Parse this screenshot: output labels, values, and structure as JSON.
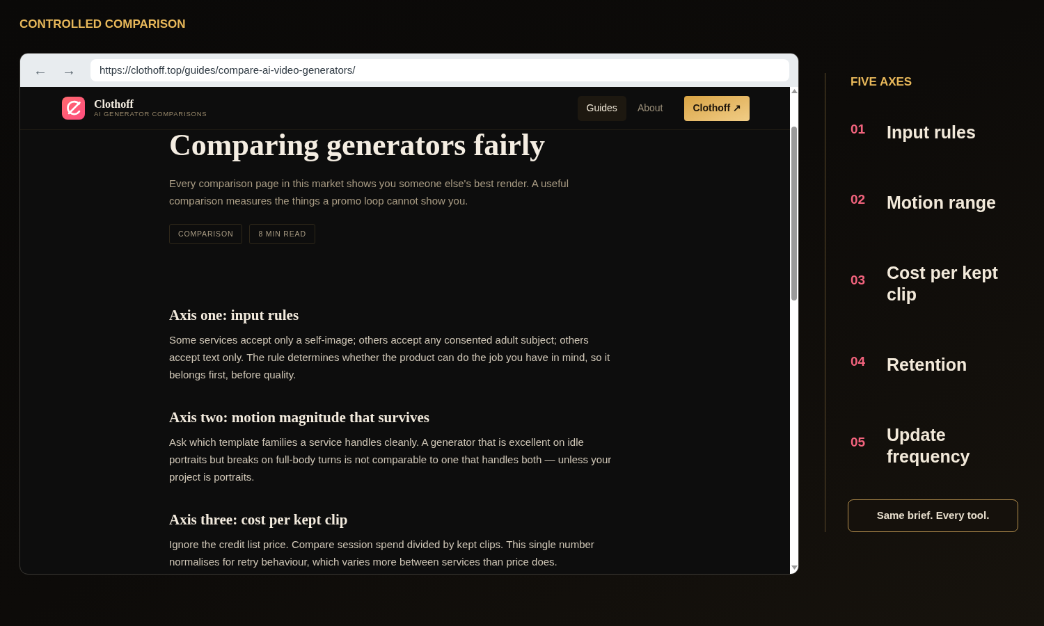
{
  "eyebrow": "CONTROLLED COMPARISON",
  "browser": {
    "back": "←",
    "forward": "→",
    "url": "https://clothoff.top/guides/compare-ai-video-generators/"
  },
  "site": {
    "brand": "Clothoff",
    "tagline": "AI GENERATOR COMPARISONS",
    "nav": [
      {
        "label": "Guides",
        "kind": "link",
        "selected": true
      },
      {
        "label": "About",
        "kind": "link",
        "selected": false
      },
      {
        "label": "Clothoff ↗",
        "kind": "cta"
      }
    ]
  },
  "article": {
    "title": "Comparing generators fairly",
    "lede": "Every comparison page in this market shows you someone else's best render. A useful comparison measures the things a promo loop cannot show you.",
    "tags": [
      "COMPARISON",
      "8 MIN READ"
    ],
    "sections": [
      {
        "heading": "Axis one: input rules",
        "body": "Some services accept only a self-image; others accept any consented adult subject; others accept text only. The rule determines whether the product can do the job you have in mind, so it belongs first, before quality."
      },
      {
        "heading": "Axis two: motion magnitude that survives",
        "body": "Ask which template families a service handles cleanly. A generator that is excellent on idle portraits but breaks on full-body turns is not comparable to one that handles both — unless your project is portraits."
      },
      {
        "heading": "Axis three: cost per kept clip",
        "body": "Ignore the credit list price. Compare session spend divided by kept clips. This single number normalises for retry behaviour, which varies more between services than price does."
      }
    ]
  },
  "sidebar": {
    "title": "FIVE AXES",
    "items": [
      {
        "number": "01",
        "label": "Input rules"
      },
      {
        "number": "02",
        "label": "Motion range"
      },
      {
        "number": "03",
        "label": "Cost per kept clip"
      },
      {
        "number": "04",
        "label": "Retention"
      },
      {
        "number": "05",
        "label": "Update frequency"
      }
    ],
    "button": "Same brief. Every tool."
  }
}
